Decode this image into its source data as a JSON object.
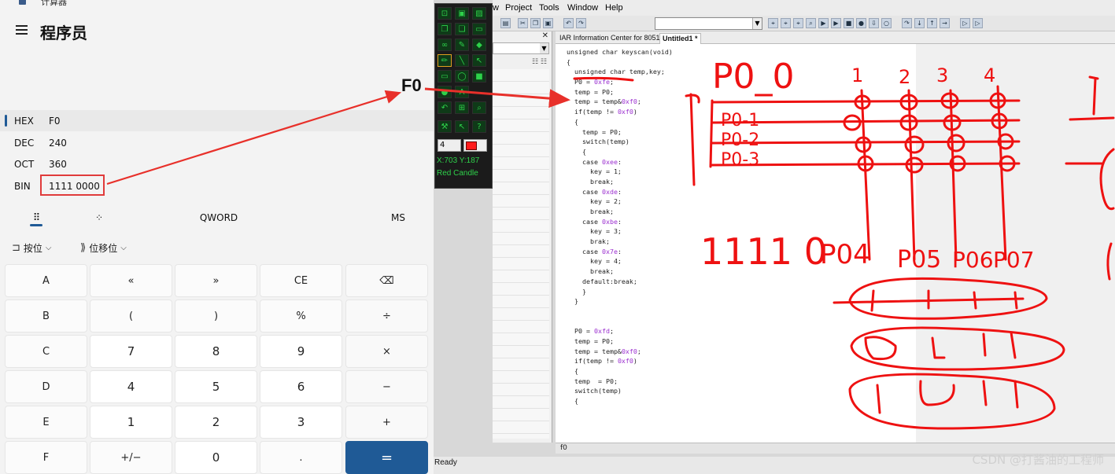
{
  "calculator": {
    "window_title": "计算器",
    "mode_title": "程序员",
    "radix": [
      {
        "label": "HEX",
        "value": "F0",
        "active": true
      },
      {
        "label": "DEC",
        "value": "240",
        "active": false
      },
      {
        "label": "OCT",
        "value": "360",
        "active": false
      },
      {
        "label": "BIN",
        "value": "1111 0000",
        "active": false
      }
    ],
    "tabs": {
      "keypad_icon": "full-keypad-icon",
      "bit_icon": "bit-toggle-icon",
      "word_size": "QWORD",
      "memory": "MS"
    },
    "bitops": {
      "bitwise": "按位",
      "shift": "位移位"
    },
    "keys": [
      [
        "A",
        "«",
        "»",
        "CE",
        "⌫"
      ],
      [
        "B",
        "(",
        ")",
        "%",
        "÷"
      ],
      [
        "C",
        "7",
        "8",
        "9",
        "×"
      ],
      [
        "D",
        "4",
        "5",
        "6",
        "−"
      ],
      [
        "E",
        "1",
        "2",
        "3",
        "+"
      ],
      [
        "F",
        "+/−",
        "0",
        ".",
        "="
      ]
    ]
  },
  "annotation": {
    "callout": "F0"
  },
  "draw_toolbar": {
    "pen_size": "4",
    "coords": "X:703  Y:187",
    "color_name": "Red Candle",
    "color": "#ff1a1a"
  },
  "ide": {
    "menu": [
      "w",
      "Project",
      "Tools",
      "Window",
      "Help"
    ],
    "doc_tabs": [
      "IAR Information Center for 8051",
      "Untitled1 *"
    ],
    "code": [
      "unsigned char keyscan(void)",
      "{",
      "  unsigned char temp,key;",
      "  P0 = 0xfe;",
      "  temp = P0;",
      "  temp = temp&0xf0;",
      "  if(temp != 0xf0)",
      "  {",
      "    temp = P0;",
      "    switch(temp)",
      "    {",
      "    case 0xee:",
      "      key = 1;",
      "      break;",
      "    case 0xde:",
      "      key = 2;",
      "      break;",
      "    case 0xbe:",
      "      key = 3;",
      "      brak;",
      "    case 0x7e:",
      "      key = 4;",
      "      break;",
      "    default:break;",
      "    }",
      "  }",
      "",
      "",
      "  P0 = 0xfd;",
      "  temp = P0;",
      "  temp = temp&0xf0;",
      "  if(temp != 0xf0)",
      "  {",
      "  temp  = P0;",
      "  switch(temp)",
      "  {"
    ],
    "scroll_label": "f0",
    "status": "Ready"
  },
  "sketch_text": {
    "title": "P0_0",
    "cols": [
      "1",
      "2",
      "3",
      "4"
    ],
    "rows": [
      "P0-1",
      "P0-2",
      "P0-3"
    ],
    "bits": "1111 0",
    "high_pins": [
      "P04",
      "P05",
      "P06",
      "P07"
    ]
  },
  "watermark": "CSDN @打酱油的工程师",
  "colors": {
    "accent": "#1f5a96",
    "annotation": "#e8302a",
    "ink": "#ee1111"
  }
}
